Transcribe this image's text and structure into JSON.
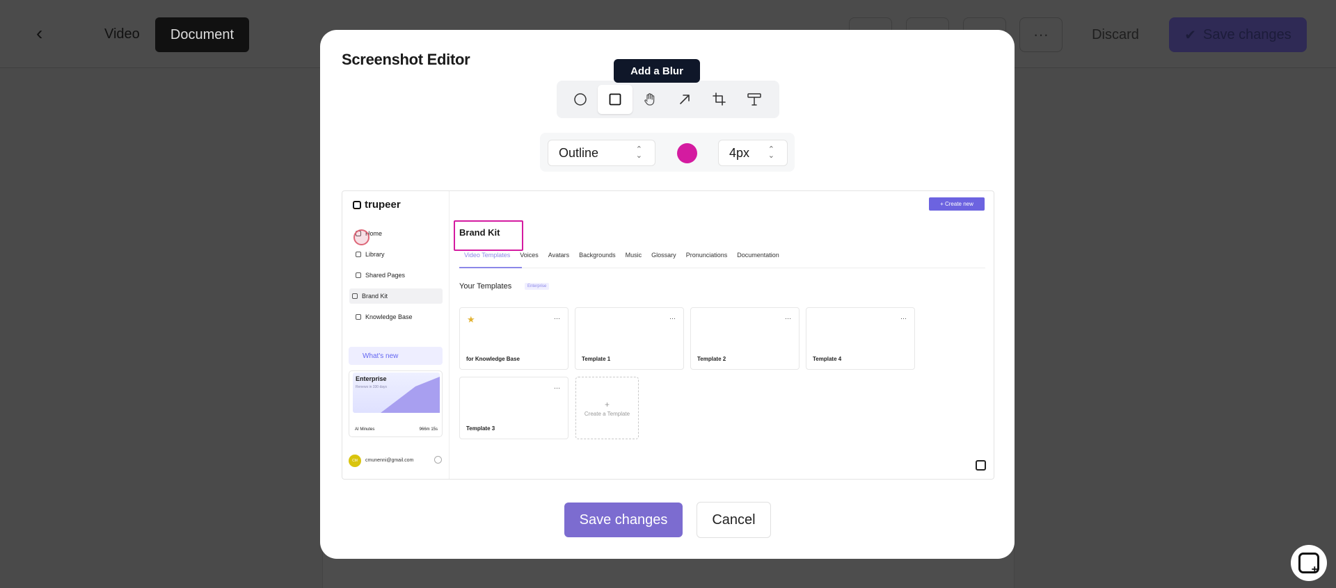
{
  "background_app": {
    "tabs": [
      "Video",
      "Document"
    ],
    "more_label": "···",
    "discard_label": "Discard",
    "save_label": "Save changes"
  },
  "modal": {
    "title": "Screenshot Editor",
    "tooltip": "Add a Blur",
    "tools": [
      {
        "name": "circle",
        "icon": "circle-icon"
      },
      {
        "name": "rectangle",
        "icon": "square-icon",
        "active": true
      },
      {
        "name": "blur",
        "icon": "hand-icon"
      },
      {
        "name": "arrow",
        "icon": "arrow-icon"
      },
      {
        "name": "crop",
        "icon": "crop-icon"
      },
      {
        "name": "text",
        "icon": "text-icon"
      }
    ],
    "style_select": "Outline",
    "color": "#d41ba0",
    "size_select": "4px",
    "save_label": "Save changes",
    "cancel_label": "Cancel"
  },
  "inner_screenshot": {
    "logo": "trupeer",
    "nav": [
      "Home",
      "Library",
      "Shared Pages",
      "Brand Kit",
      "Knowledge Base"
    ],
    "whats_new": "What's new",
    "enterprise": {
      "title": "Enterprise",
      "subtitle": "Renews in 330 days",
      "footer_left": "AI Minutes",
      "footer_right": "966m 15s"
    },
    "user_email": "cmunenni@gmail.com",
    "user_initials": "CM",
    "create_new": "+ Create new",
    "page_title": "Brand Kit",
    "subtabs": [
      "Video Templates",
      "Voices",
      "Avatars",
      "Backgrounds",
      "Music",
      "Glossary",
      "Pronunciations",
      "Documentation"
    ],
    "section_title": "Your Templates",
    "section_badge": "Enterprise",
    "templates": [
      "for Knowledge Base",
      "Template 1",
      "Template 2",
      "Template 4",
      "Template 3"
    ],
    "create_template": "Create a Template"
  }
}
